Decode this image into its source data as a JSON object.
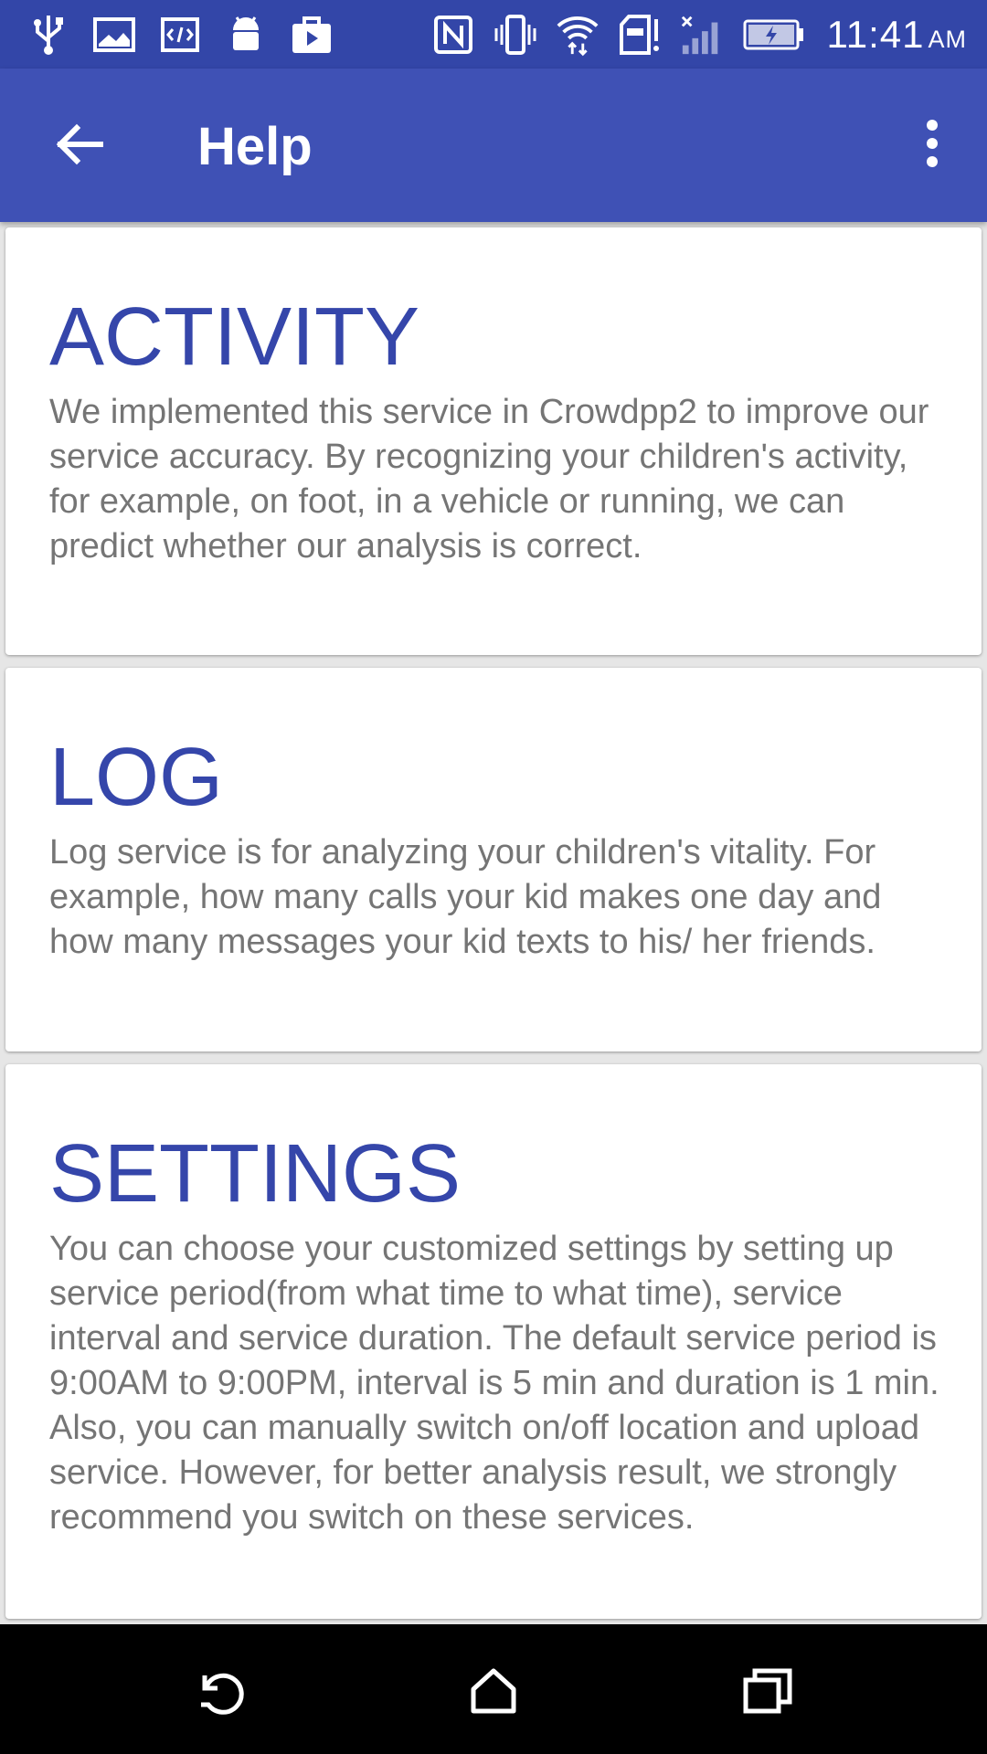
{
  "status_bar": {
    "time": "11:41",
    "ampm": "AM",
    "left_icons": [
      "usb-icon",
      "gallery-icon",
      "code-icon",
      "android-icon",
      "play-store-icon"
    ],
    "right_icons": [
      "nfc-icon",
      "vibrate-icon",
      "wifi-icon",
      "sd-card-alert-icon",
      "signal-icon",
      "battery-charging-icon"
    ]
  },
  "app_bar": {
    "title": "Help",
    "back_icon": "arrow-back-icon",
    "menu_icon": "more-vert-icon"
  },
  "cards": [
    {
      "title": "ACTIVITY",
      "body": "We implemented this service in Crowdpp2 to improve our service accuracy. By recognizing your children's activity, for example, on foot, in a vehicle or running, we can predict whether our analysis is correct."
    },
    {
      "title": "LOG",
      "body": "Log service is for analyzing your children's vitality. For example, how many calls your kid makes one day and how many messages your kid texts to his/ her friends."
    },
    {
      "title": "SETTINGS",
      "body": "You can choose your customized settings by setting up service period(from what time to what time), service interval and service duration. The default service period is 9:00AM to 9:00PM, interval is 5 min and duration is 1 min. Also, you can manually switch on/off location and upload service. However, for better analysis result, we strongly recommend you switch on these services."
    }
  ],
  "nav_bar": {
    "back_icon": "nav-back-icon",
    "home_icon": "nav-home-icon",
    "recents_icon": "nav-recents-icon"
  },
  "colors": {
    "status_bar": "#3346a8",
    "app_bar": "#3f51b5",
    "card_title": "#3546aa",
    "card_body": "#757575",
    "background": "#e6e6e6",
    "nav_bar": "#000000"
  }
}
